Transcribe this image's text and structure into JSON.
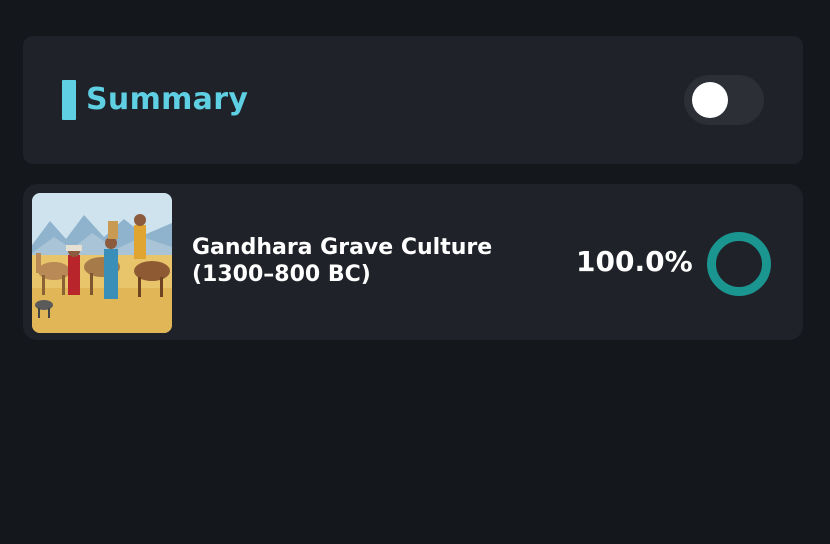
{
  "summary": {
    "title": "Summary",
    "toggle_on": false,
    "accent_color": "#5fd0e3"
  },
  "items": [
    {
      "title": "Gandhara Grave Culture (1300–800 BC)",
      "percent_label": "100.0%",
      "progress": 1.0,
      "ring_color": "#1a9590",
      "image": "illustration of travelers with camels, horses and goats in a desert"
    }
  ]
}
